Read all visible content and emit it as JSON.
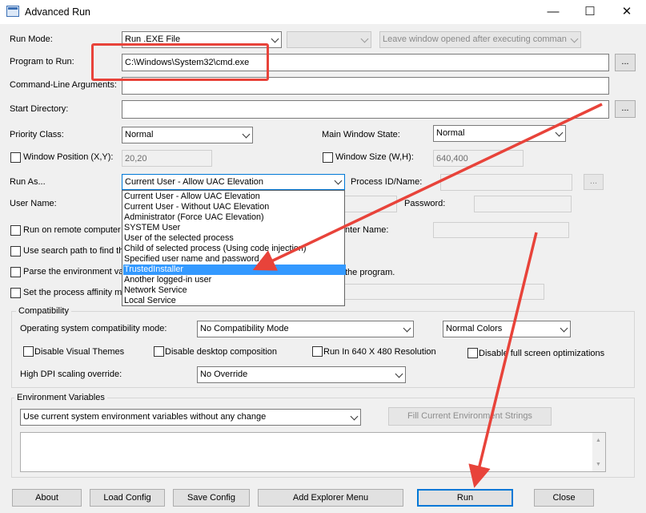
{
  "window": {
    "title": "Advanced Run",
    "minimize": "—",
    "maximize": "☐",
    "close": "✕"
  },
  "run_mode": {
    "label": "Run Mode:",
    "value": "Run .EXE File",
    "secondary": "",
    "leave_window": "Leave window opened after executing comman"
  },
  "program": {
    "label": "Program to Run:",
    "value": "C:\\Windows\\System32\\cmd.exe",
    "browse": "..."
  },
  "cmdline": {
    "label": "Command-Line Arguments:",
    "value": ""
  },
  "start_dir": {
    "label": "Start Directory:",
    "value": "",
    "browse": "..."
  },
  "priority": {
    "label": "Priority Class:",
    "value": "Normal"
  },
  "main_window_state": {
    "label": "Main Window State:",
    "value": "Normal"
  },
  "window_position": {
    "label": "Window Position (X,Y):",
    "value": "20,20"
  },
  "window_size": {
    "label": "Window Size (W,H):",
    "value": "640,400"
  },
  "run_as": {
    "label": "Run As...",
    "value": "Current User - Allow UAC Elevation",
    "options": [
      "Current User - Allow UAC Elevation",
      "Current User - Without UAC Elevation",
      "Administrator (Force UAC Elevation)",
      "SYSTEM User",
      "User of the selected process",
      "Child of selected process (Using code injection)",
      "Specified user name and password",
      "TrustedInstaller",
      "Another logged-in user",
      "Network Service",
      "Local Service"
    ],
    "selected_index": 7
  },
  "process_id": {
    "label": "Process ID/Name:",
    "value": "",
    "browse": "..."
  },
  "user_name": {
    "label": "User Name:"
  },
  "password": {
    "label": "Password:"
  },
  "remote": {
    "label_left": "Run on remote computer",
    "label_right": "nter Name:"
  },
  "search_path": {
    "label": "Use search path to find th"
  },
  "parse_env": {
    "label_left": "Parse the environment va",
    "label_right": "the program."
  },
  "affinity": {
    "label": "Set the process affinity m"
  },
  "compat": {
    "group_title": "Compatibility",
    "os_mode_label": "Operating system compatibility mode:",
    "os_mode_value": "No Compatibility Mode",
    "colors_value": "Normal Colors",
    "disable_visual_themes": "Disable Visual Themes",
    "disable_desktop_composition": "Disable desktop composition",
    "run_640": "Run In 640 X 480 Resolution",
    "disable_fullscreen_opt": "Disable full screen optimizations",
    "dpi_label": "High DPI scaling override:",
    "dpi_value": "No Override"
  },
  "env": {
    "group_title": "Environment Variables",
    "mode_value": "Use current system environment variables without any change",
    "fill_button": "Fill Current Environment Strings"
  },
  "buttons": {
    "about": "About",
    "load_config": "Load Config",
    "save_config": "Save Config",
    "add_explorer_menu": "Add Explorer Menu",
    "run": "Run",
    "close": "Close"
  },
  "colors": {
    "annotation": "#e8433a",
    "selection": "#3399ff",
    "focus": "#0078d7"
  }
}
